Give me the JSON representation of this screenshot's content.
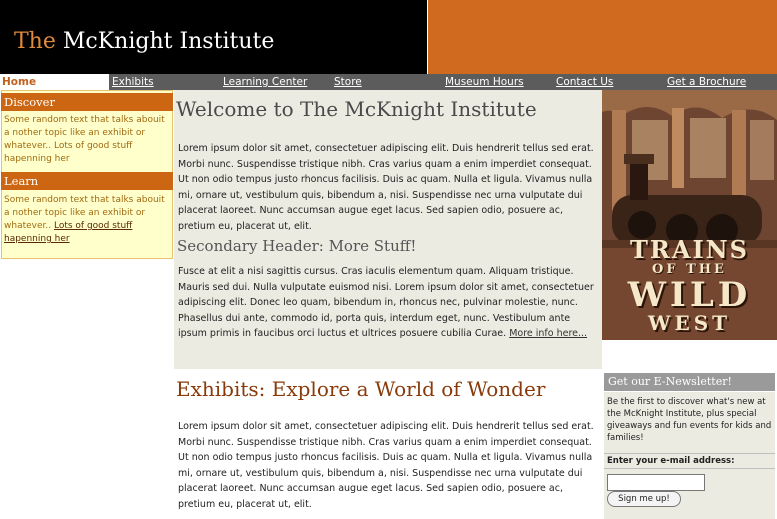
{
  "header": {
    "title_prefix": "The",
    "title_rest": "McKnight Institute"
  },
  "nav": {
    "home": "Home",
    "exhibits": "Exhibits",
    "learning_center": "Learning Center",
    "store": "Store",
    "museum_hours": "Museum Hours",
    "contact_us": "Contact Us",
    "get_brochure": "Get a Brochure"
  },
  "sidebar": {
    "discover": {
      "heading": "Discover",
      "text": "Some random text that talks abouit a nother topic like an exhibit or whatever.. Lots of good stuff hapenning her"
    },
    "learn": {
      "heading": "Learn",
      "text_before": "Some random text that talks abouit a nother topic like an exhibit or whatever.. ",
      "link": "Lots of good stuff hapenning her"
    }
  },
  "main": {
    "welcome_title": "Welcome to The McKnight Institute",
    "intro_paragraph": "Lorem ipsum dolor sit amet, consectetuer adipiscing elit. Duis hendrerit tellus sed erat. Morbi nunc. Suspendisse tristique nibh. Cras varius quam a enim imperdiet consequat. Ut non odio tempus justo rhoncus facilisis. Duis ac quam. Nulla et ligula. Vivamus nulla mi, ornare ut, vestibulum quis, bibendum a, nisi. Suspendisse nec urna vulputate dui placerat laoreet. Nunc accumsan augue eget lacus. Sed sapien odio, posuere ac, pretium eu, placerat ut, elit.",
    "secondary_header": "Secondary Header: More Stuff!",
    "secondary_paragraph": "Fusce at elit a nisi sagittis cursus. Cras iaculis elementum quam. Aliquam tristique. Mauris sed dui. Nulla vulputate euismod nisi. Lorem ipsum dolor sit amet, consectetuer adipiscing elit. Donec leo quam, bibendum in, rhoncus nec, pulvinar molestie, nunc. Phasellus dui ante, commodo id, porta quis, interdum eget, nunc. Vestibulum ante ipsum primis in faucibus orci luctus et ultrices posuere cubilia Curae.",
    "more_info_link": "More info here...",
    "exhibits_title": "Exhibits: Explore a World of Wonder",
    "exhibits_paragraph": "Lorem ipsum dolor sit amet, consectetuer adipiscing elit. Duis hendrerit tellus sed erat. Morbi nunc. Suspendisse tristique nibh. Cras varius quam a enim imperdiet consequat. Ut non odio tempus justo rhoncus facilisis. Duis ac quam. Nulla et ligula. Vivamus nulla mi, ornare ut, vestibulum quis, bibendum a, nisi. Suspendisse nec urna vulputate dui placerat laoreet. Nunc accumsan augue eget lacus. Sed sapien odio, posuere ac, pretium eu, placerat ut, elit."
  },
  "hero": {
    "line1": "TRAINS",
    "line2": "OF THE",
    "line3": "WILD",
    "line4": "WEST"
  },
  "newsletter": {
    "heading": "Get our E-Newsletter!",
    "text": "Be the first to discover what's new at the McKnight Institute, plus special giveaways and fun events for kids and families!",
    "email_label": "Enter your e-mail address:",
    "email_value": "",
    "button": "Sign me up!"
  }
}
